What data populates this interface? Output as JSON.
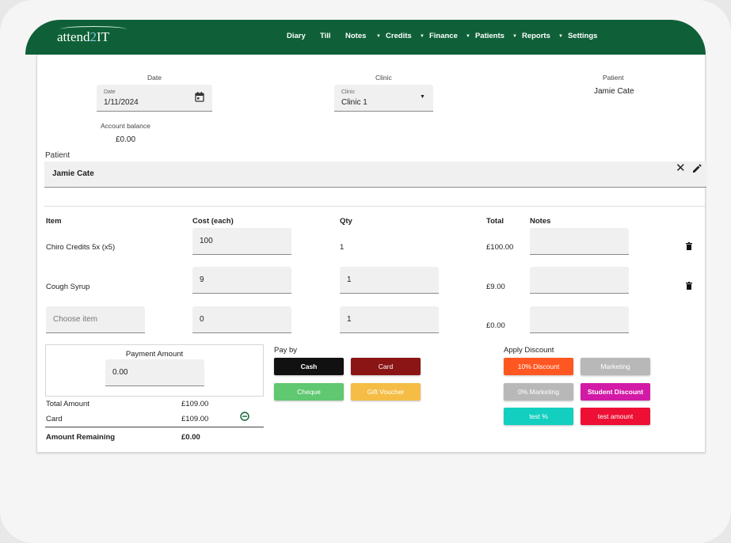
{
  "brand": {
    "logo_pre": "attend",
    "logo_two": "2",
    "logo_post": "IT"
  },
  "nav": {
    "diary": "Diary",
    "till": "Till",
    "notes": "Notes",
    "credits": "Credits",
    "finance": "Finance",
    "patients": "Patients",
    "reports": "Reports",
    "settings": "Settings",
    "caret": "▼"
  },
  "header": {
    "date_title": "Date",
    "date_field_label": "Date",
    "date_value": "1/11/2024",
    "clinic_title": "Clinic",
    "clinic_field_label": "Clinic",
    "clinic_value": "Clinic 1",
    "patient_title": "Patient",
    "patient_value": "Jamie Cate",
    "account_balance_label": "Account balance",
    "account_balance_value": "£0.00"
  },
  "patient_bar": {
    "label": "Patient",
    "value": "Jamie Cate"
  },
  "table": {
    "headers": {
      "item": "Item",
      "cost": "Cost (each)",
      "qty": "Qty",
      "total": "Total",
      "notes": "Notes"
    },
    "rows": [
      {
        "item": "Chiro Credits 5x (x5)",
        "cost": "100",
        "qty": "1",
        "total": "£100.00",
        "notes": ""
      },
      {
        "item": "Cough Syrup",
        "cost": "9",
        "qty": "1",
        "total": "£9.00",
        "notes": ""
      },
      {
        "item_placeholder": "Choose item",
        "cost": "0",
        "qty": "1",
        "total": "£0.00",
        "notes": ""
      }
    ]
  },
  "payment": {
    "amount_label": "Payment Amount",
    "amount_value": "0.00",
    "total_label": "Total Amount",
    "total_value": "£109.00",
    "card_label": "Card",
    "card_value": "£109.00",
    "remaining_label": "Amount Remaining",
    "remaining_value": "£0.00"
  },
  "pay_by": {
    "label": "Pay by",
    "cash": "Cash",
    "card": "Card",
    "cheque": "Cheque",
    "gift_voucher": "Gift Voucher"
  },
  "discount": {
    "label": "Apply Discount",
    "b1": "10% Discount",
    "b2": "Marketing",
    "b3": "0% Marketing",
    "b4": "Student Discount",
    "b5": "test %",
    "b6": "test amount"
  },
  "colors": {
    "brand_green": "#0f6038",
    "cash": "#111111",
    "card": "#8b1515",
    "cheque": "#5fc870",
    "gift": "#f5bd45",
    "discount10": "#ff5722",
    "grey": "#b8b8b8",
    "student": "#d21aa6",
    "test_pct": "#13cfc0",
    "test_amount": "#ee0f35"
  }
}
